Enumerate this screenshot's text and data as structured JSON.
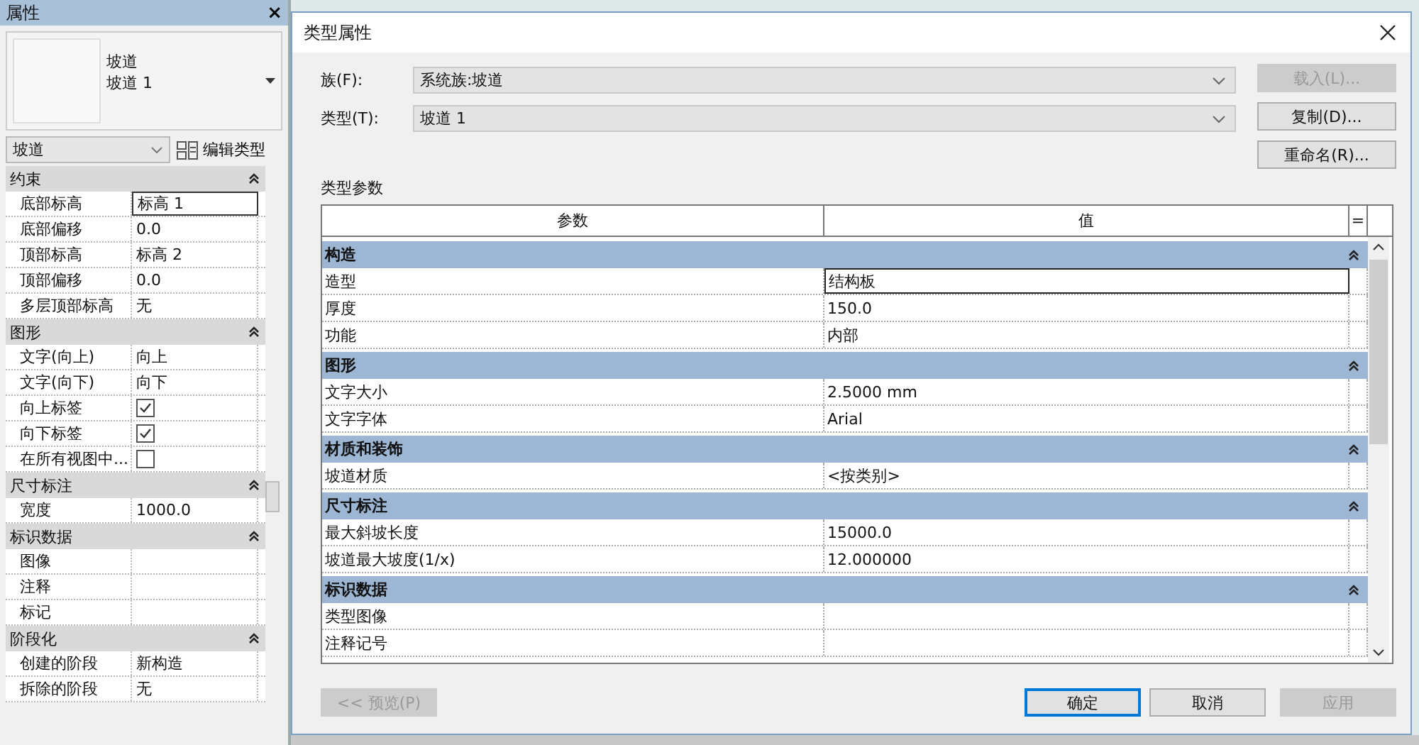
{
  "properties_panel": {
    "title": "属性",
    "close": "×",
    "preview": {
      "line1": "坡道",
      "line2": "坡道 1"
    },
    "type_select": "坡道",
    "edit_type_button": "编辑类型",
    "groups": [
      {
        "name": "约束",
        "expanded": true,
        "rows": [
          {
            "label": "底部标高",
            "kind": "text",
            "value": "标高 1",
            "selected": true
          },
          {
            "label": "底部偏移",
            "kind": "text",
            "value": "0.0",
            "selected": false
          },
          {
            "label": "顶部标高",
            "kind": "text",
            "value": "标高 2",
            "selected": false
          },
          {
            "label": "顶部偏移",
            "kind": "text",
            "value": "0.0",
            "selected": false
          },
          {
            "label": "多层顶部标高",
            "kind": "text",
            "value": "无",
            "selected": false
          }
        ]
      },
      {
        "name": "图形",
        "expanded": true,
        "rows": [
          {
            "label": "文字(向上)",
            "kind": "text",
            "value": "向上",
            "selected": false
          },
          {
            "label": "文字(向下)",
            "kind": "text",
            "value": "向下",
            "selected": false
          },
          {
            "label": "向上标签",
            "kind": "checkbox",
            "checked": true,
            "selected": false
          },
          {
            "label": "向下标签",
            "kind": "checkbox",
            "checked": true,
            "selected": false
          },
          {
            "label": "在所有视图中...",
            "kind": "checkbox",
            "checked": false,
            "selected": false
          }
        ]
      },
      {
        "name": "尺寸标注",
        "expanded": true,
        "rows": [
          {
            "label": "宽度",
            "kind": "text",
            "value": "1000.0",
            "selected": false
          }
        ]
      },
      {
        "name": "标识数据",
        "expanded": true,
        "rows": [
          {
            "label": "图像",
            "kind": "text",
            "selected": false
          },
          {
            "label": "注释",
            "kind": "text",
            "selected": false
          },
          {
            "label": "标记",
            "kind": "text",
            "selected": false
          }
        ]
      },
      {
        "name": "阶段化",
        "expanded": true,
        "rows": [
          {
            "label": "创建的阶段",
            "kind": "text",
            "value": "新构造",
            "selected": false
          },
          {
            "label": "拆除的阶段",
            "kind": "text",
            "value": "无",
            "selected": false
          }
        ]
      }
    ]
  },
  "dialog": {
    "title": "类型属性",
    "family": {
      "label": "族(F):",
      "value": "系统族:坡道"
    },
    "type": {
      "label": "类型(T):",
      "value": "坡道 1"
    },
    "side_buttons": [
      {
        "label": "载入(L)...",
        "disabled": true
      },
      {
        "label": "复制(D)...",
        "disabled": false
      },
      {
        "label": "重命名(R)...",
        "disabled": false
      }
    ],
    "section_label": "类型参数",
    "columns": [
      "参数",
      "值"
    ],
    "equals": "=",
    "groups": [
      {
        "name": "构造",
        "expanded": true,
        "rows": [
          {
            "label": "造型",
            "value": "结构板",
            "selected": true
          },
          {
            "label": "厚度",
            "value": "150.0",
            "selected": false
          },
          {
            "label": "功能",
            "value": "内部",
            "selected": false
          }
        ]
      },
      {
        "name": "图形",
        "expanded": true,
        "rows": [
          {
            "label": "文字大小",
            "value": "2.5000 mm",
            "selected": false
          },
          {
            "label": "文字字体",
            "value": "Arial",
            "selected": false
          }
        ]
      },
      {
        "name": "材质和装饰",
        "expanded": true,
        "rows": [
          {
            "label": "坡道材质",
            "value": "<按类别>",
            "selected": false
          }
        ]
      },
      {
        "name": "尺寸标注",
        "expanded": true,
        "rows": [
          {
            "label": "最大斜坡长度",
            "value": "15000.0",
            "selected": false
          },
          {
            "label": "坡道最大坡度(1/x)",
            "value": "12.000000",
            "selected": false
          }
        ]
      },
      {
        "name": "标识数据",
        "expanded": true,
        "rows": [
          {
            "label": "类型图像",
            "selected": false
          },
          {
            "label": "注释记号",
            "selected": false
          }
        ]
      }
    ],
    "footer_buttons": [
      {
        "label": "<< 预览(P)",
        "disabled": true,
        "default": false
      },
      {
        "label": "确定",
        "disabled": false,
        "default": true
      },
      {
        "label": "取消",
        "disabled": false,
        "default": false
      },
      {
        "label": "应用",
        "disabled": true,
        "default": false
      }
    ]
  }
}
